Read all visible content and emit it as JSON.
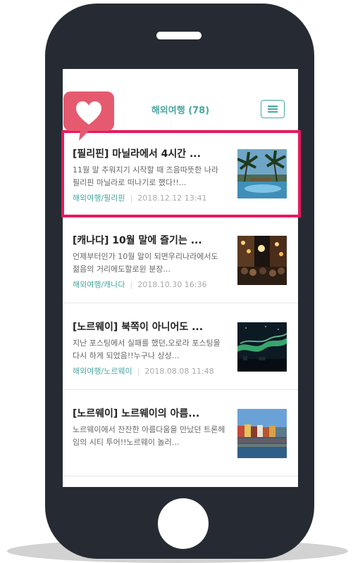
{
  "app_header": {
    "title": "해외여행 (78)",
    "menu_icon": "hamburger-menu-icon"
  },
  "badge_icon": "heart-icon",
  "colors": {
    "accent": "#4aa7a0",
    "highlight": "#e8195d",
    "badge": "#e55a6e",
    "device": "#262b33"
  },
  "posts": [
    {
      "title": "[필리핀] 마닐라에서 4시간 ...",
      "summary": "11월 말 추워지기 시작할 때 즈음따뜻한 나라 필리핀 마닐라로 떠나기로 했다!!...",
      "category": "해외여행/필리핀",
      "date": "2018.12.12 13:41",
      "thumbnail": "beach-resort-pool-photo"
    },
    {
      "title": "[캐나다] 10월 말에 즐기는 ...",
      "summary": "언제부터인가 10월 말이 되면우리나라에서도 젊음의 거리에도할로윈 분장...",
      "category": "해외여행/캐나다",
      "date": "2018.10.30 16:36",
      "thumbnail": "night-street-crowd-photo"
    },
    {
      "title": "[노르웨이] 북쪽이 아니어도 ...",
      "summary": "지난 포스팅에서 실패를 했던,오로라 포스팅을 다시 하게 되었음!!누구나 상상...",
      "category": "해외여행/노르웨이",
      "date": "2018.08.08 11:48",
      "thumbnail": "aurora-night-sky-photo"
    },
    {
      "title": "[노르웨이] 노르웨이의 아름...",
      "summary": "노르웨이에서 잔잔한 아름다움을 만났던 트론헤임의 시티 투어!!노르웨이 놀러...",
      "thumbnail": "harbor-houses-photo"
    }
  ]
}
